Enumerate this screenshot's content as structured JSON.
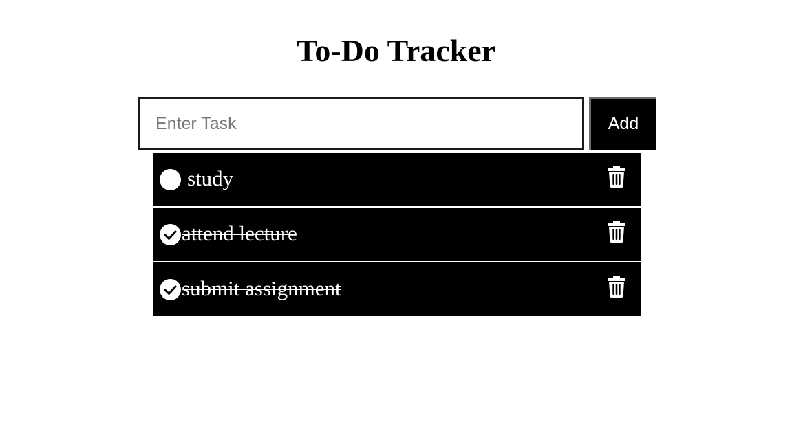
{
  "header": {
    "title": "To-Do Tracker"
  },
  "task_form": {
    "input_placeholder": "Enter Task",
    "input_value": "",
    "add_label": "Add"
  },
  "tasks": [
    {
      "text": "study",
      "completed": false
    },
    {
      "text": "attend lecture",
      "completed": true
    },
    {
      "text": "submit assignment",
      "completed": true
    }
  ],
  "icons": {
    "check": "check-circle-icon",
    "delete": "trash-icon"
  },
  "colors": {
    "task_background": "#000000",
    "task_text": "#ffffff",
    "add_button_background": "#000000",
    "placeholder": "#777777"
  }
}
